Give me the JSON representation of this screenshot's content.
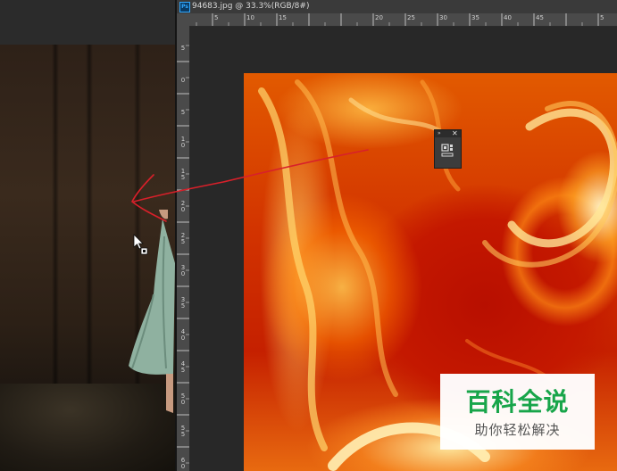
{
  "document_tab": {
    "app_icon_text": "Ps",
    "title": "94683.jpg @ 33.3%(RGB/8#)"
  },
  "ruler_top": {
    "labels": [
      "5",
      "10",
      "15",
      "20",
      "25",
      "30",
      "35",
      "40",
      "45",
      "5"
    ]
  },
  "ruler_left": {
    "labels": [
      "5",
      "0",
      "5",
      "1 0",
      "1 5",
      "2 0",
      "2 5",
      "3 0",
      "3 5",
      "4 0",
      "4 5",
      "5 0",
      "5 5",
      "6 0"
    ]
  },
  "floating_panel": {
    "collapse_glyph": "»",
    "close_glyph": "✕",
    "tool_icon": "layer-comp-icon"
  },
  "watermark": {
    "title": "百科全说",
    "subtitle": "助你轻松解决",
    "title_color": "#18a54a"
  },
  "annotation": {
    "stroke_color": "#d8202a"
  }
}
